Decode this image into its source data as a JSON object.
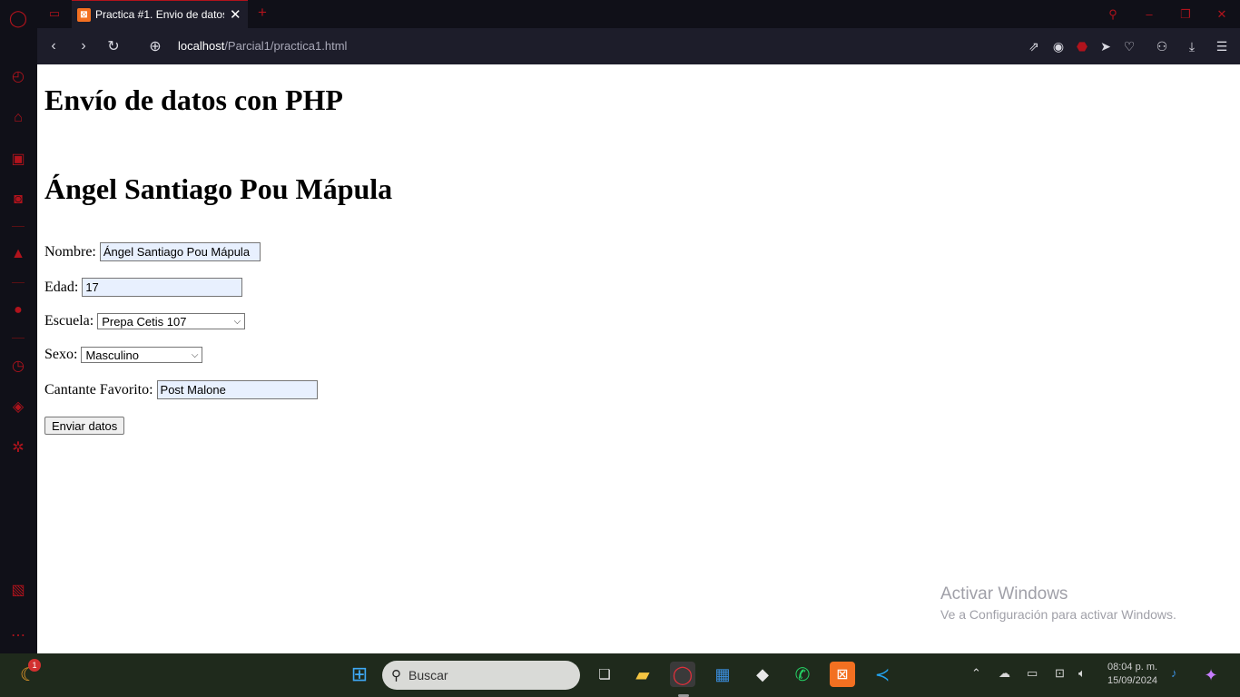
{
  "browser": {
    "tab_title": "Practica #1. Envio de datos con PHP",
    "url_host": "localhost",
    "url_path": "/Parcial1/practica1.html"
  },
  "page": {
    "heading": "Envío de datos con PHP",
    "subheading": "Ángel Santiago Pou Mápula",
    "form": {
      "nombre_label": "Nombre:",
      "nombre_value": "Ángel Santiago Pou Mápula",
      "edad_label": "Edad:",
      "edad_value": "17",
      "escuela_label": "Escuela:",
      "escuela_value": "Prepa Cetis 107",
      "sexo_label": "Sexo:",
      "sexo_value": "Masculino",
      "cantante_label": "Cantante Favorito:",
      "cantante_value": "Post Malone",
      "submit_label": "Enviar datos"
    }
  },
  "watermark": {
    "line1": "Activar Windows",
    "line2": "Ve a Configuración para activar Windows."
  },
  "taskbar": {
    "search_placeholder": "Buscar",
    "weather_badge": "1",
    "time": "08:04 p. m.",
    "date": "15/09/2024"
  },
  "colors": {
    "accent": "#b0131c",
    "page_bg": "#ffffff",
    "input_autofill": "#e8f0fe"
  }
}
